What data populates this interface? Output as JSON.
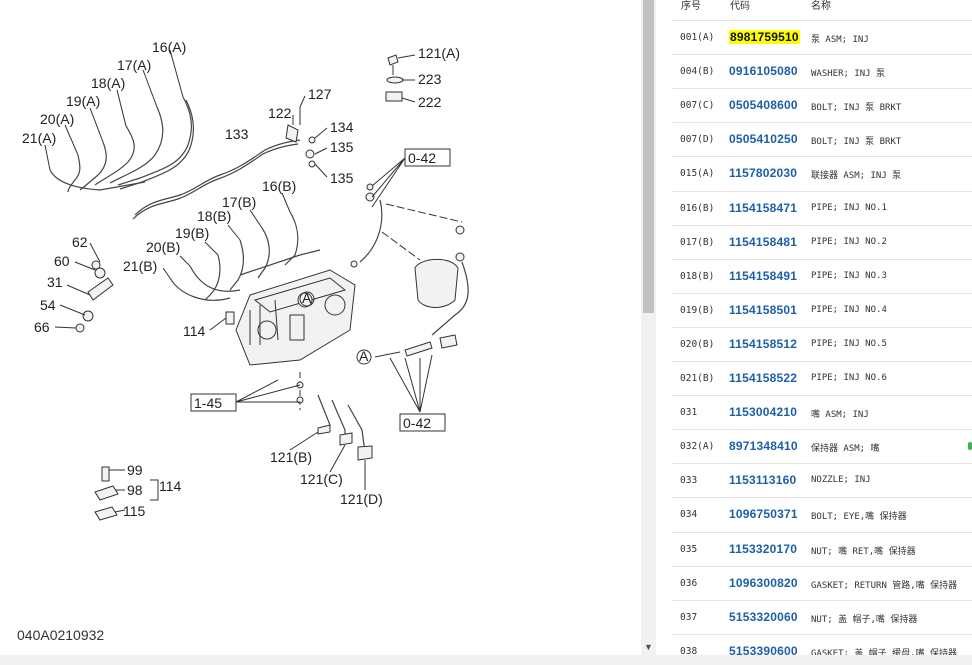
{
  "diagram": {
    "drawing_code": "040A0210932",
    "callouts": [
      "16(A)",
      "17(A)",
      "18(A)",
      "19(A)",
      "20(A)",
      "21(A)",
      "121(A)",
      "223",
      "222",
      "127",
      "122",
      "134",
      "135",
      "135",
      "133",
      "0-42",
      "16(B)",
      "17(B)",
      "18(B)",
      "19(B)",
      "20(B)",
      "21(B)",
      "62",
      "60",
      "31",
      "54",
      "66",
      "114",
      "1-45",
      "0-42",
      "121(B)",
      "121(C)",
      "121(D)",
      "99",
      "98",
      "114",
      "115"
    ]
  },
  "parts_table": {
    "headers": {
      "seq": "序号",
      "part_no": "代码",
      "name": "名称"
    },
    "rows": [
      {
        "seq": "001(A)",
        "part_no": "8981759510",
        "name": "泵 ASM; INJ",
        "highlight": true
      },
      {
        "seq": "004(B)",
        "part_no": "0916105080",
        "name": "WASHER; INJ 泵"
      },
      {
        "seq": "007(C)",
        "part_no": "0505408600",
        "name": "BOLT; INJ 泵 BRKT"
      },
      {
        "seq": "007(D)",
        "part_no": "0505410250",
        "name": "BOLT; INJ 泵 BRKT"
      },
      {
        "seq": "015(A)",
        "part_no": "1157802030",
        "name": "联接器 ASM; INJ 泵"
      },
      {
        "seq": "016(B)",
        "part_no": "1154158471",
        "name": "PIPE; INJ NO.1"
      },
      {
        "seq": "017(B)",
        "part_no": "1154158481",
        "name": "PIPE; INJ NO.2"
      },
      {
        "seq": "018(B)",
        "part_no": "1154158491",
        "name": "PIPE; INJ NO.3"
      },
      {
        "seq": "019(B)",
        "part_no": "1154158501",
        "name": "PIPE; INJ NO.4"
      },
      {
        "seq": "020(B)",
        "part_no": "1154158512",
        "name": "PIPE; INJ NO.5"
      },
      {
        "seq": "021(B)",
        "part_no": "1154158522",
        "name": "PIPE; INJ NO.6"
      },
      {
        "seq": "031",
        "part_no": "1153004210",
        "name": "嘴 ASM; INJ"
      },
      {
        "seq": "032(A)",
        "part_no": "8971348410",
        "name": "保持器 ASM; 嘴",
        "marker": true
      },
      {
        "seq": "033",
        "part_no": "1153113160",
        "name": "NOZZLE; INJ"
      },
      {
        "seq": "034",
        "part_no": "1096750371",
        "name": "BOLT; EYE,嘴 保持器"
      },
      {
        "seq": "035",
        "part_no": "1153320170",
        "name": "NUT; 嘴 RET,嘴 保持器"
      },
      {
        "seq": "036",
        "part_no": "1096300820",
        "name": "GASKET; RETURN 管路,嘴 保持器"
      },
      {
        "seq": "037",
        "part_no": "5153320060",
        "name": "NUT; 盖 帽子,嘴 保持器"
      },
      {
        "seq": "038",
        "part_no": "5153390600",
        "name": "GASKET; 盖 帽子 缓母,嘴 保持器"
      }
    ]
  },
  "colors": {
    "part_link": "#1c5fa8",
    "highlight": "#ffff00",
    "marker": "#3bb54a"
  },
  "icons": {
    "scroll_down": "▼"
  }
}
